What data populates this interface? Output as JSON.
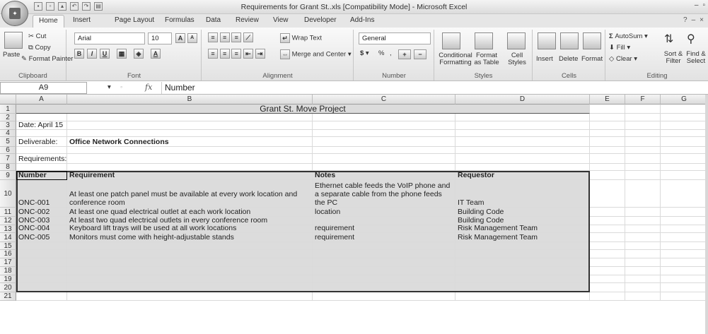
{
  "window": {
    "title": "Requirements for Grant St..xls  [Compatibility Mode] - Microsoft Excel",
    "controls": [
      "–",
      "▫",
      "✕"
    ]
  },
  "ribbon_tabs": [
    "Home",
    "Insert",
    "Page Layout",
    "Formulas",
    "Data",
    "Review",
    "View",
    "Developer",
    "Add-Ins"
  ],
  "ribbon": {
    "clipboard": {
      "paste": "Paste",
      "cut": "Cut",
      "copy": "Copy",
      "format_painter": "Format Painter",
      "label": "Clipboard"
    },
    "font": {
      "name": "Arial",
      "size": "10",
      "label": "Font"
    },
    "alignment": {
      "wrap_text": "Wrap Text",
      "merge_center": "Merge and Center",
      "label": "Alignment"
    },
    "number": {
      "format": "General",
      "currency": "$",
      "percent": "%",
      "comma": ",",
      "inc": ".0→.00",
      "dec": ".00→.0",
      "label": "Number"
    },
    "styles": {
      "conditional": "Conditional Formatting",
      "format_table": "Format as Table",
      "cell_styles": "Cell Styles",
      "label": "Styles"
    },
    "cells": {
      "insert": "Insert",
      "delete": "Delete",
      "format": "Format",
      "label": "Cells"
    },
    "editing": {
      "autosum": "AutoSum",
      "fill": "Fill",
      "clear": "Clear",
      "sort_filter": "Sort & Filter",
      "find_select": "Find & Select",
      "label": "Editing"
    }
  },
  "formula_bar": {
    "name_box": "A9",
    "fx": "fx",
    "content": "Number"
  },
  "columns": [
    "A",
    "B",
    "C",
    "D",
    "E",
    "F",
    "G"
  ],
  "rows": [
    "1",
    "2",
    "3",
    "4",
    "5",
    "6",
    "7",
    "8",
    "9",
    "10",
    "11",
    "12",
    "13",
    "14",
    "15",
    "16",
    "17",
    "18",
    "19",
    "20",
    "21"
  ],
  "sheet": {
    "title": "Grant St. Move Project",
    "date": "Date: April 15",
    "deliverable_label": "Deliverable:",
    "deliverable_value": "Office Network Connections",
    "requirements_label": "Requirements:",
    "headers": [
      "Number",
      "Requirement",
      "Notes",
      "Requestor"
    ],
    "rows": [
      {
        "number": "ONC-001",
        "requirement": "At least one patch panel must be available at every work location and conference room",
        "notes": "Ethernet cable feeds the VoIP phone and a separate cable from the phone feeds the PC",
        "requestor": "IT Team"
      },
      {
        "number": "ONC-002",
        "requirement": "At least one quad electrical outlet at each work location",
        "notes": "Only one power strip is allowed per work location",
        "requestor": "Building Code"
      },
      {
        "number": "ONC-003",
        "requirement": "At least two quad electrical outlets in every conference room",
        "notes": "",
        "requestor": "Building Code"
      },
      {
        "number": "ONC-004",
        "requirement": "Keyboard lift trays will be used at all work locations",
        "notes": "This is a corporate ergonomic requirement",
        "requestor": "Risk Management Team"
      },
      {
        "number": "ONC-005",
        "requirement": "Monitors must come with height-adjustable stands",
        "notes": "This is a corporate ergonomic requirement",
        "requestor": "Risk Management Team"
      }
    ]
  }
}
